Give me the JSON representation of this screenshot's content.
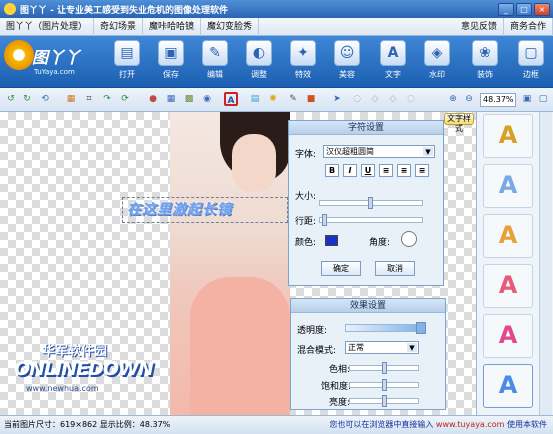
{
  "window": {
    "title": "图丫丫 - 让专业美工感受到失业危机的图像处理软件"
  },
  "menu": {
    "items": [
      "图丫丫（图片处理）",
      "奇幻场景",
      "魔咔哈哈镜",
      "魔幻变脸秀"
    ],
    "right": [
      "意见反馈",
      "商务合作"
    ]
  },
  "logo": {
    "name": "图丫丫",
    "sub": "TuYaya.com"
  },
  "main_tools": [
    {
      "label": "打开",
      "icon": "open-folder-icon",
      "glyph": "▤"
    },
    {
      "label": "保存",
      "icon": "save-disk-icon",
      "glyph": "▣"
    },
    {
      "label": "编辑",
      "icon": "edit-icon",
      "glyph": "✎"
    },
    {
      "label": "调整",
      "icon": "adjust-icon",
      "glyph": "◐"
    },
    {
      "label": "特效",
      "icon": "effects-icon",
      "glyph": "✦"
    },
    {
      "label": "美容",
      "icon": "beauty-icon",
      "glyph": "☺"
    },
    {
      "label": "文字",
      "icon": "text-icon",
      "glyph": "A"
    },
    {
      "label": "水印",
      "icon": "watermark-icon",
      "glyph": "◈"
    },
    {
      "label": "装饰",
      "icon": "decoration-icon",
      "glyph": "❀"
    },
    {
      "label": "边框",
      "icon": "frame-icon",
      "glyph": "▢"
    }
  ],
  "zoom": {
    "value": "48.37%"
  },
  "canvas": {
    "art_text": "在这里激起长镜",
    "watermark_cn": "华军软件园",
    "watermark_en": "ONLINEDOWN",
    "watermark_url": "www.newhua.com"
  },
  "font_panel": {
    "title": "字符设置",
    "font_label": "字体:",
    "font_value": "汉仪超粗圆简",
    "format_buttons": [
      "B",
      "I",
      "U",
      "≡",
      "≡",
      "≡"
    ],
    "size_label": "大小:",
    "spacing_label": "行距:",
    "color_label": "颜色:",
    "angle_label": "角度:",
    "text_color": "#1a32c8",
    "ok_label": "确定",
    "cancel_label": "取消"
  },
  "effect_panel": {
    "title": "效果设置",
    "opacity_label": "透明度:",
    "blend_label": "混合模式:",
    "blend_value": "正常",
    "hue_label": "色相:",
    "saturation_label": "饱和度:",
    "brightness_label": "亮度:"
  },
  "style_tab": {
    "label": "文字样式"
  },
  "styles": [
    {
      "glyph": "A",
      "color": "#d8a020"
    },
    {
      "glyph": "A",
      "color": "#7aa8e8"
    },
    {
      "glyph": "A",
      "color": "#e8a03a"
    },
    {
      "glyph": "A",
      "color": "#e85a7a"
    },
    {
      "glyph": "A",
      "color": "#e04a8a"
    },
    {
      "glyph": "A",
      "color": "#4a8ae8"
    }
  ],
  "status": {
    "left": "当前图片尺寸：619×862   显示比例：48.37%",
    "right_prefix": "您也可以在浏览器中直接输入 ",
    "right_url": "www.tuyaya.com",
    "right_suffix": " 使用本软件"
  }
}
